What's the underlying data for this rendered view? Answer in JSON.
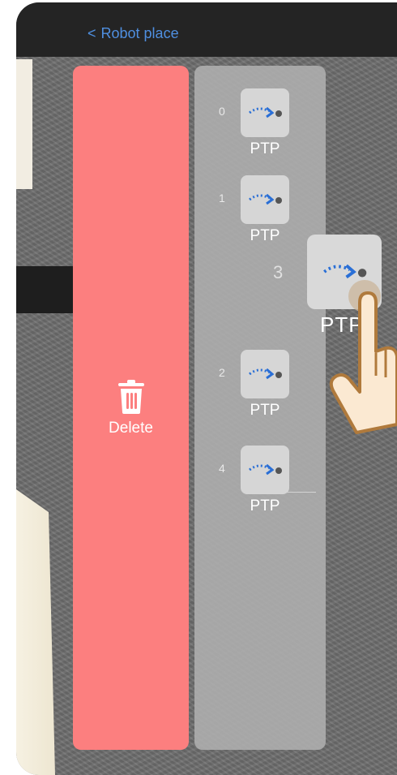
{
  "header": {
    "back_glyph": "<",
    "back_label": "Robot place"
  },
  "delete_zone": {
    "label": "Delete",
    "icon": "trash-icon",
    "color": "#fc7f7f"
  },
  "points": [
    {
      "index": "0",
      "label": "PTP",
      "icon": "ptp-arrow-icon"
    },
    {
      "index": "1",
      "label": "PTP",
      "icon": "ptp-arrow-icon"
    },
    {
      "index": "2",
      "label": "PTP",
      "icon": "ptp-arrow-icon"
    },
    {
      "index": "4",
      "label": "PTP",
      "icon": "ptp-arrow-icon"
    }
  ],
  "dragging": {
    "index": "3",
    "label": "PTP",
    "icon": "ptp-arrow-icon"
  },
  "colors": {
    "accent": "#2a6fd6",
    "header_bg": "#242424",
    "back_link": "#4f8fe0"
  }
}
